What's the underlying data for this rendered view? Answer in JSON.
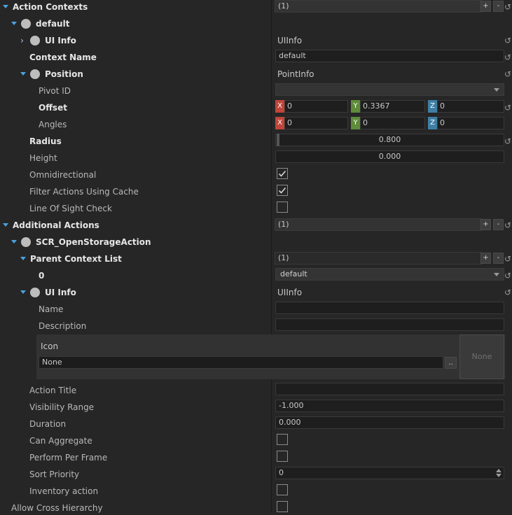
{
  "action_contexts": {
    "label": "Action Contexts",
    "count_text": "(1)",
    "plus_label": "+",
    "minus_label": "-",
    "default_entry": {
      "label": "default",
      "ui_info": {
        "label": "UI Info",
        "value": "UIInfo"
      },
      "context_name": {
        "label": "Context Name",
        "value": "default"
      },
      "position": {
        "label": "Position",
        "value": "PointInfo",
        "pivot_id": {
          "label": "Pivot ID",
          "value": ""
        },
        "offset": {
          "label": "Offset",
          "x": "0",
          "y": "0.3367",
          "z": "0"
        },
        "angles": {
          "label": "Angles",
          "x": "0",
          "y": "0",
          "z": "0"
        }
      },
      "radius": {
        "label": "Radius",
        "value": "0.800"
      },
      "height": {
        "label": "Height",
        "value": "0.000"
      },
      "omnidirectional": {
        "label": "Omnidirectional",
        "checked": true
      },
      "filter_actions": {
        "label": "Filter Actions Using Cache",
        "checked": true
      },
      "line_of_sight": {
        "label": "Line Of Sight Check",
        "checked": false
      }
    }
  },
  "axis_labels": {
    "x": "X",
    "y": "Y",
    "z": "Z"
  },
  "additional_actions": {
    "label": "Additional Actions",
    "count_text": "(1)",
    "plus_label": "+",
    "minus_label": "-",
    "entry": {
      "label": "SCR_OpenStorageAction",
      "parent_context_list": {
        "label": "Parent Context List",
        "count_text": "(1)",
        "plus_label": "+",
        "minus_label": "-",
        "item0": {
          "label": "0",
          "value": "default"
        }
      },
      "ui_info": {
        "label": "UI Info",
        "value": "UIInfo",
        "name": {
          "label": "Name",
          "value": ""
        },
        "description": {
          "label": "Description",
          "value": ""
        },
        "icon": {
          "label": "Icon",
          "value": "None",
          "browse_label": "..",
          "preview_text": "None"
        }
      },
      "action_title": {
        "label": "Action Title",
        "value": ""
      },
      "visibility_range": {
        "label": "Visibility Range",
        "value": "-1.000"
      },
      "duration": {
        "label": "Duration",
        "value": "0.000"
      },
      "can_aggregate": {
        "label": "Can Aggregate",
        "checked": false
      },
      "perform_per_frame": {
        "label": "Perform Per Frame",
        "checked": false
      },
      "sort_priority": {
        "label": "Sort  Priority",
        "value": "0"
      },
      "inventory_action": {
        "label": "Inventory action",
        "checked": false
      }
    }
  },
  "allow_cross_hierarchy": {
    "label": "Allow Cross Hierarchy",
    "checked": false
  },
  "reset_glyph": "↺",
  "colors": {
    "expand_arrow": "#4aa3e0",
    "axis_x": "#c0453a",
    "axis_y": "#5e8c3a",
    "axis_z": "#3f7fa5",
    "background": "#262626"
  }
}
